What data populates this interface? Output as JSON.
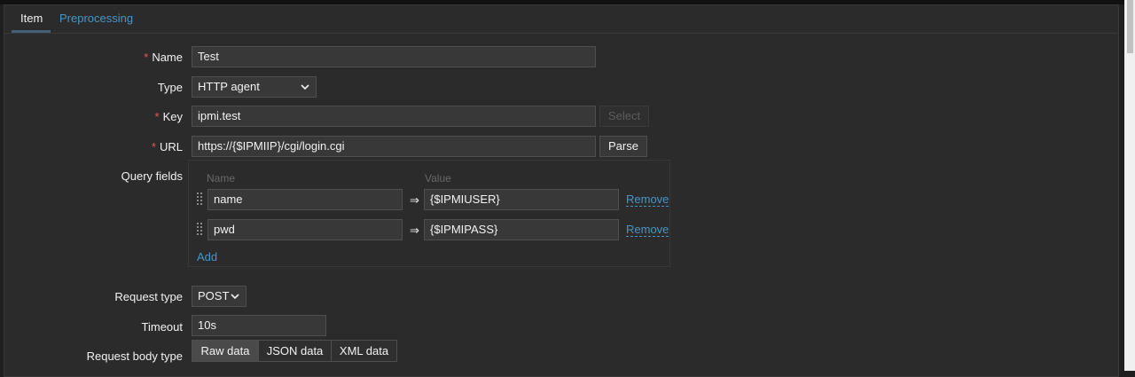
{
  "tabs": [
    {
      "label": "Item",
      "active": true
    },
    {
      "label": "Preprocessing",
      "active": false
    }
  ],
  "form": {
    "name": {
      "label": "Name",
      "required": "*",
      "value": "Test"
    },
    "type": {
      "label": "Type",
      "value": "HTTP agent"
    },
    "key": {
      "label": "Key",
      "required": "*",
      "value": "ipmi.test",
      "select_label": "Select"
    },
    "url": {
      "label": "URL",
      "required": "*",
      "value": "https://{$IPMIIP}/cgi/login.cgi",
      "parse_label": "Parse"
    },
    "query_fields": {
      "label": "Query fields",
      "col_name": "Name",
      "col_value": "Value",
      "arrow": "⇒",
      "rows": [
        {
          "name": "name",
          "value": "{$IPMIUSER}",
          "remove": "Remove"
        },
        {
          "name": "pwd",
          "value": "{$IPMIPASS}",
          "remove": "Remove"
        }
      ],
      "add_label": "Add"
    },
    "request_type": {
      "label": "Request type",
      "value": "POST"
    },
    "timeout": {
      "label": "Timeout",
      "value": "10s"
    },
    "request_body_type": {
      "label": "Request body type",
      "options": [
        "Raw data",
        "JSON data",
        "XML data"
      ],
      "selected": "Raw data"
    }
  },
  "icons": {
    "dropdown": "chevron-down-icon",
    "drag": "drag-handle-icon"
  },
  "colors": {
    "link": "#4796c4",
    "required": "#e45959",
    "panel": "#2b2b2b"
  }
}
